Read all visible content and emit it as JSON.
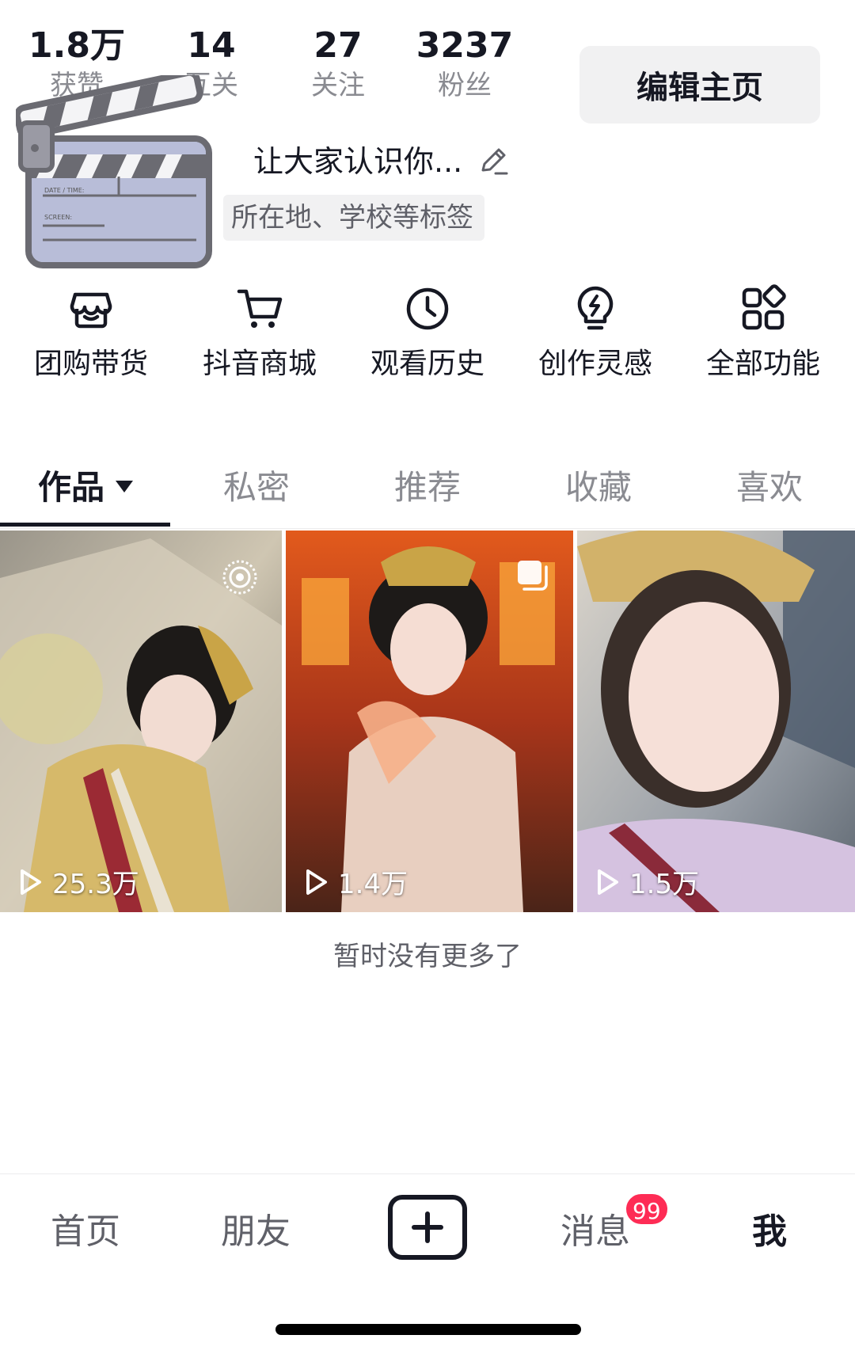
{
  "stats": {
    "likes": {
      "value": "1.8万",
      "label": "获赞"
    },
    "mutual": {
      "value": "14",
      "label": "互关"
    },
    "following": {
      "value": "27",
      "label": "关注"
    },
    "fans": {
      "value": "3237",
      "label": "粉丝"
    }
  },
  "edit_profile_label": "编辑主页",
  "sticker": {
    "date_label": "DATE / TIME:",
    "screen_label": "SCREEN:"
  },
  "bio": {
    "prompt": "让大家认识你...",
    "tag_prompt": "所在地、学校等标签"
  },
  "features": [
    {
      "label": "团购带货",
      "icon": "store-icon"
    },
    {
      "label": "抖音商城",
      "icon": "cart-icon"
    },
    {
      "label": "观看历史",
      "icon": "clock-icon"
    },
    {
      "label": "创作灵感",
      "icon": "lightbulb-icon"
    },
    {
      "label": "全部功能",
      "icon": "grid-icon"
    }
  ],
  "tabs": [
    "作品",
    "私密",
    "推荐",
    "收藏",
    "喜欢"
  ],
  "active_tab": "作品",
  "videos": [
    {
      "views": "25.3万",
      "badge": "live-icon"
    },
    {
      "views": "1.4万",
      "badge": "multi-image-icon"
    },
    {
      "views": "1.5万",
      "badge": ""
    }
  ],
  "no_more_text": "暂时没有更多了",
  "bottom_nav": {
    "home": "首页",
    "friends": "朋友",
    "messages": "消息",
    "messages_badge": "99",
    "me": "我"
  },
  "colors": {
    "accent": "#fe2c55",
    "text_primary": "#161823",
    "text_secondary": "#8a8b91"
  }
}
